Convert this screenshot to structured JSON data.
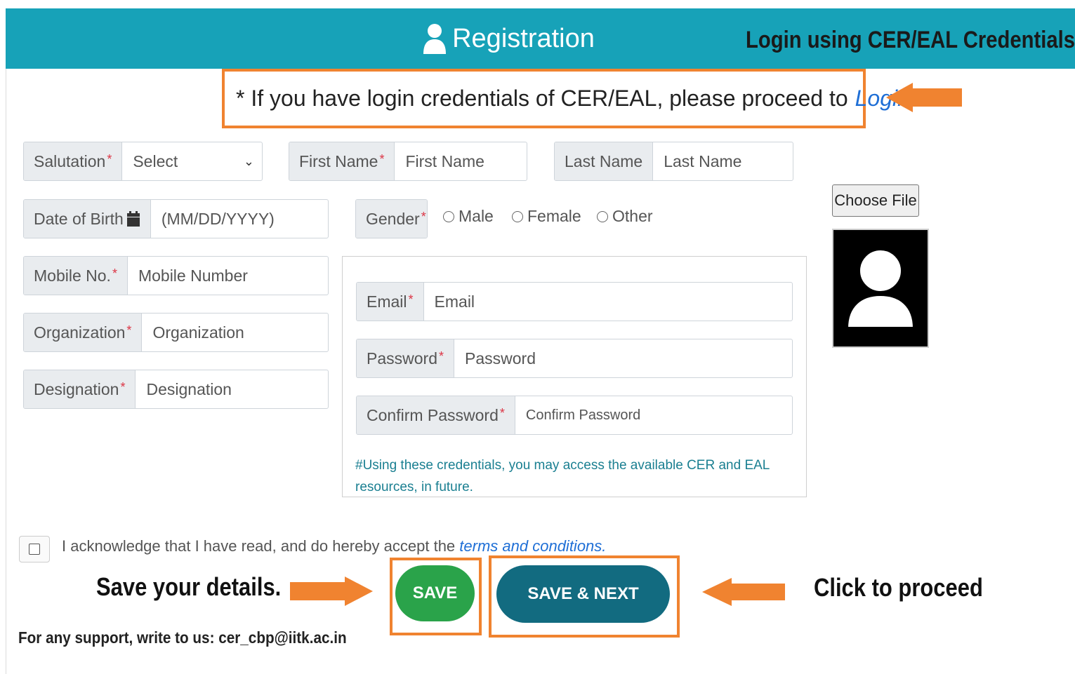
{
  "header": {
    "title": "Registration",
    "annotation": "Login using CER/EAL Credentials",
    "color": "#17a2b8"
  },
  "callout": {
    "text": "* If you have login credentials of CER/EAL, please proceed to",
    "link": "Login"
  },
  "form": {
    "salutation": {
      "label": "Salutation",
      "required": "*",
      "value": "Select"
    },
    "first_name": {
      "label": "First Name",
      "required": "*",
      "placeholder": "First Name"
    },
    "last_name": {
      "label": "Last Name",
      "placeholder": "Last Name"
    },
    "dob": {
      "label": "Date of Birth",
      "placeholder": "(MM/DD/YYYY)",
      "icon": "calendar-icon"
    },
    "gender": {
      "label": "Gender",
      "required": "*",
      "options": [
        "Male",
        "Female",
        "Other"
      ]
    },
    "mobile": {
      "label": "Mobile No.",
      "required": "*",
      "placeholder": "Mobile Number"
    },
    "organization": {
      "label": "Organization",
      "required": "*",
      "placeholder": "Organization"
    },
    "designation": {
      "label": "Designation",
      "required": "*",
      "placeholder": "Designation"
    },
    "email": {
      "label": "Email",
      "required": "*",
      "placeholder": "Email"
    },
    "password": {
      "label": "Password",
      "required": "*",
      "placeholder": "Password"
    },
    "confirm_password": {
      "label": "Confirm Password",
      "required": "*",
      "placeholder": "Confirm Password"
    },
    "credentials_note": "#Using these credentials, you may access the available CER and EAL resources, in future."
  },
  "photo": {
    "choose_file_label": "Choose File",
    "icon": "avatar-placeholder-icon"
  },
  "acknowledge": {
    "text": "I acknowledge that I have read, and do hereby accept the",
    "link": "terms and conditions."
  },
  "annotations": {
    "save_note": "Save your details.",
    "proceed_note": "Click to proceed",
    "arrow_color": "#f08330"
  },
  "buttons": {
    "save": "SAVE",
    "save_next": "SAVE & NEXT",
    "save_color": "#2aa34a",
    "save_next_color": "#126b80"
  },
  "support_text": "For any support, write to us: cer_cbp@iitk.ac.in"
}
